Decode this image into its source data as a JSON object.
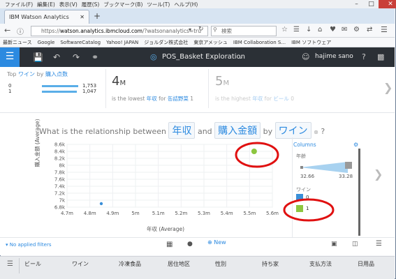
{
  "browser": {
    "menu": [
      "ファイル(F)",
      "編集(E)",
      "表示(V)",
      "履歴(S)",
      "ブックマーク(B)",
      "ツール(T)",
      "ヘルプ(H)"
    ],
    "tab_title": "IBM Watson Analytics",
    "url_prefix": "https://",
    "url_domain": "watson.analytics.ibmcloud.com",
    "url_rest": "/?watsonanalytics=tru",
    "search_placeholder": "検索",
    "bookmarks": [
      "最新ニュース",
      "Google",
      "SoftwareCatalog",
      "Yahoo! JAPAN",
      "ジョルダン株式会社",
      "東京アメッシュ",
      "IBM Collaboration S...",
      "IBM ソフトウェア"
    ]
  },
  "app": {
    "title": "POS_Basket Exploration",
    "user": "hajime sano"
  },
  "suggestions": {
    "card1": {
      "prefix": "Top",
      "field": "ワイン",
      "by": "by",
      "measure": "購入点数",
      "row_labels": [
        "0",
        "1"
      ],
      "row_values": [
        "1,753",
        "1,047"
      ]
    },
    "card2": {
      "value": "4",
      "unit": "M",
      "text": "is the lowest",
      "measure": "年収",
      "for": "for",
      "item": "缶詰野菜",
      "count": "1"
    },
    "card3": {
      "value": "5",
      "unit": "M",
      "text": "is the highest",
      "measure": "年収",
      "for": "for",
      "item": "ビール",
      "count": "0"
    }
  },
  "question": {
    "lead": "What is the relationship between",
    "field1": "年収",
    "and": "and",
    "field2": "購入金額",
    "by": "by",
    "field3": "ワイン",
    "help": "?"
  },
  "chart_data": {
    "type": "scatter",
    "xlabel": "年収 (Average)",
    "ylabel": "購入金額 (Average)",
    "xlim": [
      4.7,
      5.6
    ],
    "ylim": [
      6.8,
      8.6
    ],
    "xticks": [
      "4.7m",
      "4.8m",
      "4.9m",
      "5m",
      "5.1m",
      "5.2m",
      "5.3m",
      "5.4m",
      "5.5m",
      "5.6m"
    ],
    "yticks": [
      "6.8k",
      "7k",
      "7.2k",
      "7.4k",
      "7.6k",
      "7.8k",
      "8k",
      "8.2k",
      "8.4k",
      "8.6k"
    ],
    "series": [
      {
        "name": "0",
        "color": "#3a8fd8",
        "x": 4.85,
        "y": 6.9
      },
      {
        "name": "1",
        "color": "#8cc63f",
        "x": 5.52,
        "y": 8.4
      }
    ]
  },
  "columns_panel": {
    "title": "Columns",
    "size_label": "年齢",
    "size_min": "32.66",
    "size_max": "33.28",
    "color_label": "ワイン",
    "legend": [
      {
        "label": "0",
        "color": "#3a8fd8"
      },
      {
        "label": "1",
        "color": "#8cc63f"
      }
    ]
  },
  "footer": {
    "filters": "No applied filters",
    "new": "New"
  },
  "columns_bar": [
    "ビール",
    "ワイン",
    "冷凍食品",
    "居住地区",
    "性別",
    "持ち家",
    "支払方法",
    "日用品"
  ]
}
